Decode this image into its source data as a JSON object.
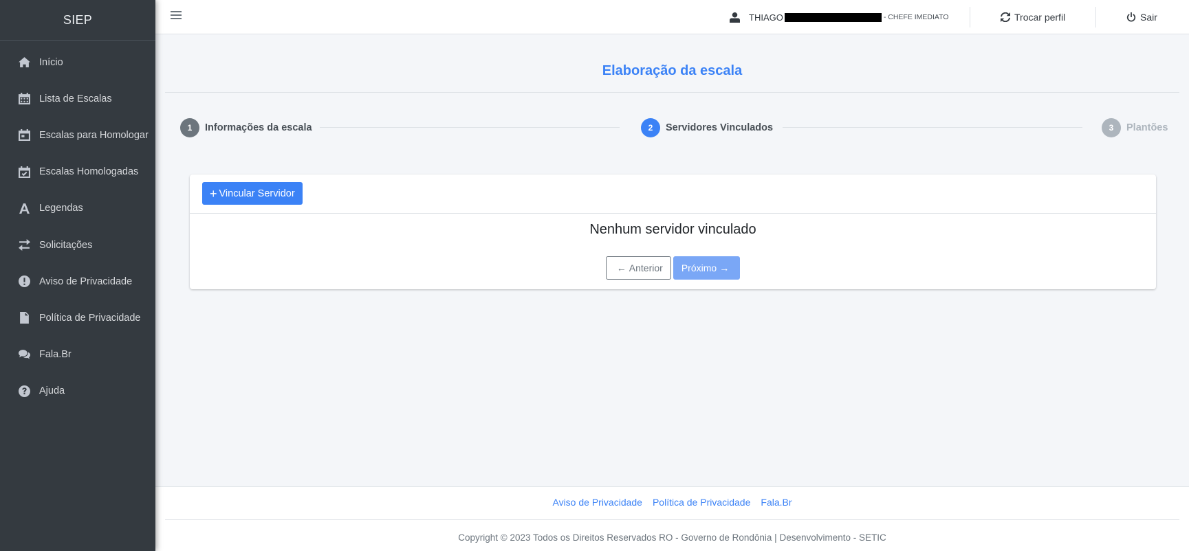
{
  "brand": "SIEP",
  "sidebar": {
    "items": [
      {
        "label": "Início",
        "icon": "home-icon"
      },
      {
        "label": "Lista de Escalas",
        "icon": "calendar-grid-icon"
      },
      {
        "label": "Escalas para Homologar",
        "icon": "calendar-icon"
      },
      {
        "label": "Escalas Homologadas",
        "icon": "calendar-check-icon"
      },
      {
        "label": "Legendas",
        "icon": "font-icon"
      },
      {
        "label": "Solicitações",
        "icon": "exchange-icon"
      },
      {
        "label": "Aviso de Privacidade",
        "icon": "exclamation-circle-icon"
      },
      {
        "label": "Política de Privacidade",
        "icon": "file-icon"
      },
      {
        "label": "Fala.Br",
        "icon": "comments-icon"
      },
      {
        "label": "Ajuda",
        "icon": "question-circle-icon"
      }
    ]
  },
  "topbar": {
    "user_name": "THIAGO",
    "user_role": "- CHEFE IMEDIATO",
    "switch_profile": "Trocar perfil",
    "logout": "Sair"
  },
  "page": {
    "title": "Elaboração da escala"
  },
  "stepper": {
    "steps": [
      {
        "number": "1",
        "label": "Informações da escala",
        "state": "done"
      },
      {
        "number": "2",
        "label": "Servidores Vinculados",
        "state": "active"
      },
      {
        "number": "3",
        "label": "Plantões",
        "state": "pending"
      }
    ]
  },
  "card": {
    "link_button": "Vincular Servidor",
    "empty_message": "Nenhum servidor vinculado",
    "prev_button": "Anterior",
    "next_button": "Próximo"
  },
  "footer": {
    "links": [
      "Aviso de Privacidade",
      "Política de Privacidade",
      "Fala.Br"
    ],
    "copyright": "Copyright © 2023 Todos os Direitos Reservados RO - Governo de Rondônia | Desenvolvimento - SETIC"
  },
  "colors": {
    "sidebar_bg": "#343a40",
    "accent": "#3b82f6",
    "step_done": "#6c757d",
    "step_pending": "#adb5bd"
  }
}
